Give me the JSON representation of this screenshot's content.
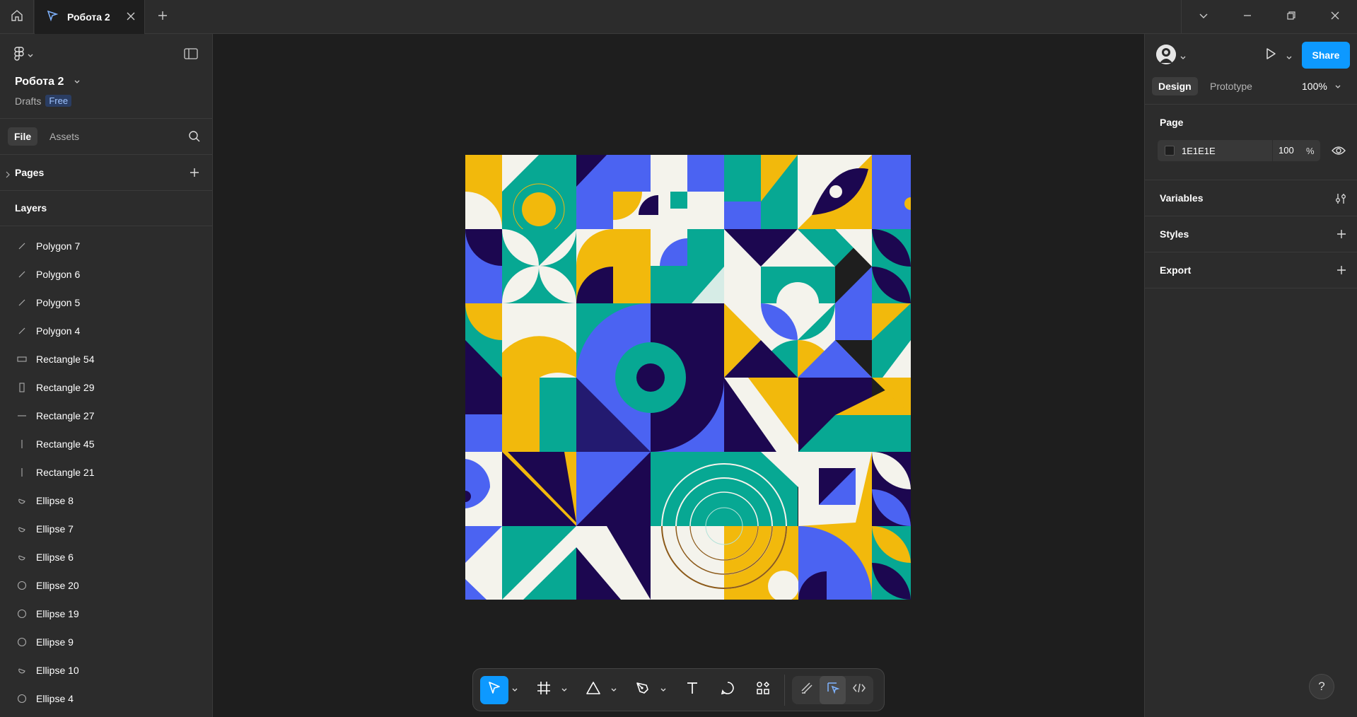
{
  "titlebar": {
    "tab_title": "Робота 2"
  },
  "left_panel": {
    "file_name": "Робота 2",
    "location": "Drafts",
    "plan_badge": "Free",
    "tabs": {
      "file": "File",
      "assets": "Assets"
    },
    "pages_label": "Pages",
    "layers_label": "Layers",
    "layers": [
      {
        "name": "Polygon 7",
        "icon": "polygon-line-icon"
      },
      {
        "name": "Polygon 6",
        "icon": "polygon-line-icon"
      },
      {
        "name": "Polygon 5",
        "icon": "polygon-line-icon"
      },
      {
        "name": "Polygon 4",
        "icon": "polygon-line-icon"
      },
      {
        "name": "Rectangle 54",
        "icon": "rectangle-icon"
      },
      {
        "name": "Rectangle 29",
        "icon": "rectangle-tall-icon"
      },
      {
        "name": "Rectangle 27",
        "icon": "line-horizontal-icon"
      },
      {
        "name": "Rectangle 45",
        "icon": "line-vertical-icon"
      },
      {
        "name": "Rectangle 21",
        "icon": "line-vertical-icon"
      },
      {
        "name": "Ellipse 8",
        "icon": "ellipse-arc-icon"
      },
      {
        "name": "Ellipse 7",
        "icon": "ellipse-arc-icon"
      },
      {
        "name": "Ellipse 6",
        "icon": "ellipse-arc-icon"
      },
      {
        "name": "Ellipse 20",
        "icon": "ellipse-icon"
      },
      {
        "name": "Ellipse 19",
        "icon": "ellipse-icon"
      },
      {
        "name": "Ellipse 9",
        "icon": "ellipse-icon"
      },
      {
        "name": "Ellipse 10",
        "icon": "ellipse-arc-icon"
      },
      {
        "name": "Ellipse 4",
        "icon": "ellipse-icon"
      }
    ]
  },
  "right_panel": {
    "share_label": "Share",
    "tabs": {
      "design": "Design",
      "prototype": "Prototype"
    },
    "zoom": "100%",
    "page_label": "Page",
    "page_color": "1E1E1E",
    "page_opacity": "100",
    "opacity_unit": "%",
    "variables_label": "Variables",
    "styles_label": "Styles",
    "export_label": "Export",
    "help_label": "?"
  },
  "toolbar": {
    "tools": [
      "move-icon",
      "frame-icon",
      "shape-icon",
      "pen-icon",
      "text-icon",
      "comment-icon",
      "actions-icon"
    ],
    "modes": [
      "draw-mode-icon",
      "design-mode-icon",
      "dev-mode-icon"
    ]
  },
  "colors": {
    "accent": "#0d99ff",
    "canvas_bg": "#1e1e1e",
    "panel_bg": "#2c2c2c",
    "art_yellow": "#f2b90c",
    "art_teal": "#07a893",
    "art_blue": "#4b63f2",
    "art_navy": "#1c0750",
    "art_cream": "#f4f3ec"
  }
}
